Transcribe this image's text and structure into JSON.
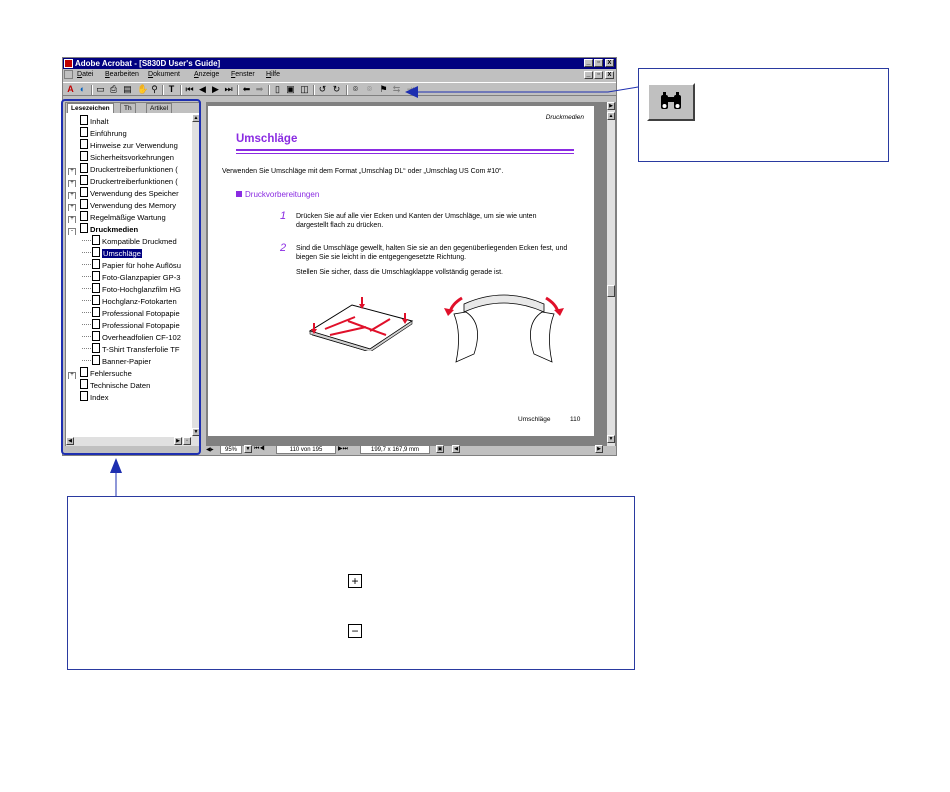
{
  "window": {
    "title": "Adobe Acrobat - [S830D User's Guide]",
    "controls": {
      "min": "_",
      "max": "1",
      "close": "x"
    }
  },
  "menu": {
    "items": [
      {
        "accel": "D",
        "rest": "atei"
      },
      {
        "accel": "B",
        "rest": "earbeiten"
      },
      {
        "accel": "D",
        "rest": "okument",
        "prefix": ""
      },
      {
        "accel": "A",
        "rest": "nzeige"
      },
      {
        "accel": "F",
        "rest": "enster"
      },
      {
        "accel": "H",
        "rest": "ilfe"
      }
    ]
  },
  "nav": {
    "tabs": [
      "Lesezeichen",
      "Th",
      "Artikel"
    ],
    "items": [
      {
        "label": "Inhalt",
        "level": 0,
        "expander": ""
      },
      {
        "label": "Einführung",
        "level": 0,
        "expander": ""
      },
      {
        "label": "Hinweise zur Verwendung",
        "level": 0,
        "expander": ""
      },
      {
        "label": "Sicherheitsvorkehrungen",
        "level": 0,
        "expander": ""
      },
      {
        "label": "Druckertreiberfunktionen (",
        "level": 0,
        "expander": "+"
      },
      {
        "label": "Druckertreiberfunktionen (",
        "level": 0,
        "expander": "+"
      },
      {
        "label": "Verwendung des Speicher",
        "level": 0,
        "expander": "+"
      },
      {
        "label": "Verwendung des Memory",
        "level": 0,
        "expander": "+"
      },
      {
        "label": "Regelmäßige Wartung",
        "level": 0,
        "expander": "+"
      },
      {
        "label": "Druckmedien",
        "level": 0,
        "expander": "-",
        "bold": true
      },
      {
        "label": "Kompatible Druckmed",
        "level": 1,
        "expander": ""
      },
      {
        "label": "Umschläge",
        "level": 1,
        "expander": "",
        "selected": true
      },
      {
        "label": "Papier für hohe Auflösu",
        "level": 1,
        "expander": ""
      },
      {
        "label": "Foto-Glanzpapier GP-3",
        "level": 1,
        "expander": ""
      },
      {
        "label": "Foto-Hochglanzfilm HG",
        "level": 1,
        "expander": ""
      },
      {
        "label": "Hochglanz-Fotokarten",
        "level": 1,
        "expander": ""
      },
      {
        "label": "Professional Fotopapie",
        "level": 1,
        "expander": ""
      },
      {
        "label": "Professional Fotopapie",
        "level": 1,
        "expander": ""
      },
      {
        "label": "Overheadfolien CF-102",
        "level": 1,
        "expander": ""
      },
      {
        "label": "T-Shirt Transferfolie TF",
        "level": 1,
        "expander": ""
      },
      {
        "label": "Banner-Papier",
        "level": 1,
        "expander": ""
      },
      {
        "label": "Fehlersuche",
        "level": 0,
        "expander": "+"
      },
      {
        "label": "Technische Daten",
        "level": 0,
        "expander": ""
      },
      {
        "label": "Index",
        "level": 0,
        "expander": ""
      }
    ]
  },
  "page": {
    "header_right": "Druckmedien",
    "title": "Umschläge",
    "intro": "Verwenden Sie Umschläge mit dem Format „Umschlag DL“ oder „Umschlag US Com #10“.",
    "section": "Druckvorbereitungen",
    "steps": [
      {
        "num": "1",
        "text": "Drücken Sie auf alle vier Ecken und Kanten der Umschläge, um sie wie unten dargestellt flach zu drücken."
      },
      {
        "num": "2",
        "text": "Sind die Umschläge gewellt, halten Sie sie an den gegenüberliegenden Ecken fest, und biegen Sie sie leicht in die entgegengesetzte Richtung."
      }
    ],
    "note": "Stellen Sie sicher, dass die Umschlagklappe vollständig gerade ist.",
    "footer_label": "Umschläge",
    "footer_page": "110"
  },
  "statusbar": {
    "zoom": "95%",
    "page_of": "110 von 195",
    "size": "199,7 x 167,9 mm"
  },
  "callouts": {
    "plus_symbol": "+",
    "minus_symbol": "−"
  },
  "colors": {
    "accent_purple": "#8a2be2",
    "callout_blue": "#1e2fb0",
    "title_blue": "#000080"
  }
}
